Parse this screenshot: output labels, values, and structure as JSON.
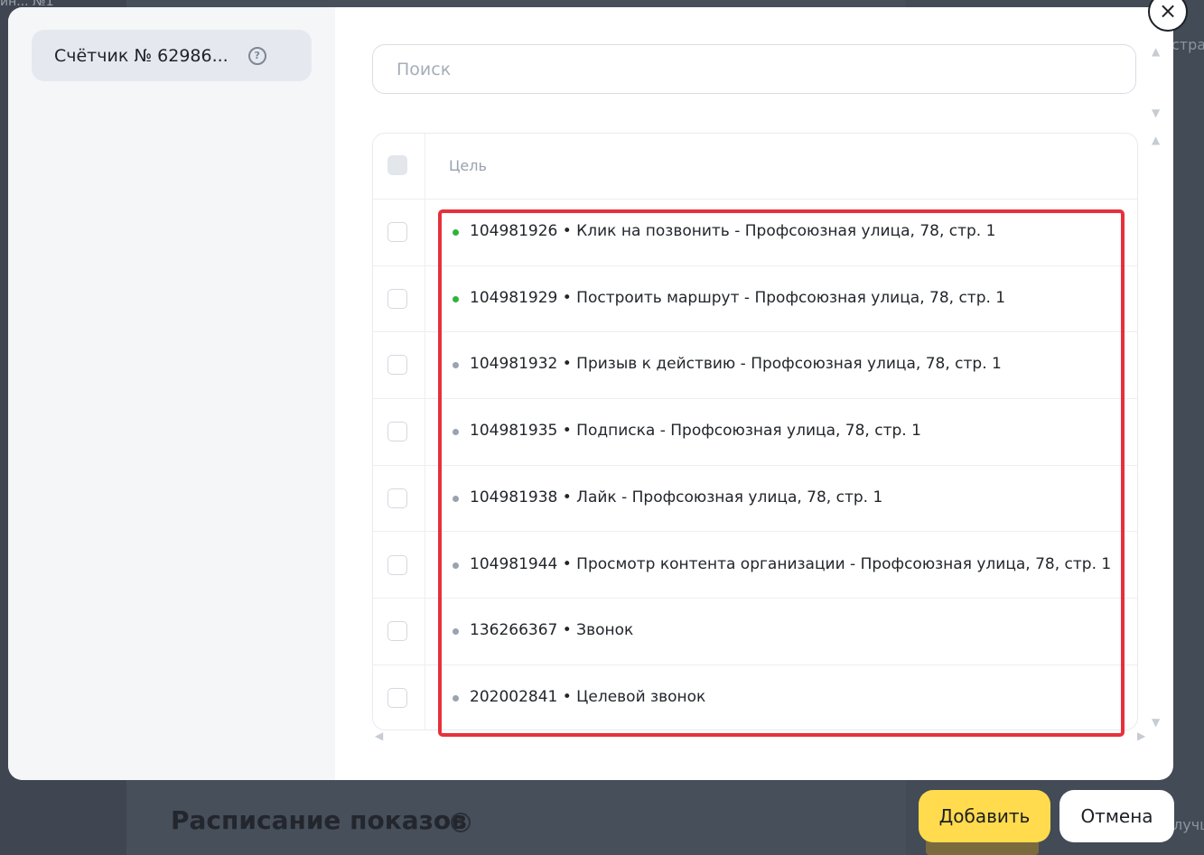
{
  "background": {
    "top_crumb": "ин... №1",
    "right_text_top": "стра",
    "right_text_bottom": "лучш",
    "heading": "Расписание показов",
    "heading_help": "?"
  },
  "sidebar": {
    "counter_label": "Счётчик № 62986...",
    "help": "?"
  },
  "search": {
    "placeholder": "Поиск",
    "value": ""
  },
  "table": {
    "column_title": "Цель",
    "rows": [
      {
        "text": "104981926 • Клик на позвонить - Профсоюзная улица, 78, стр. 1",
        "status_color": "#2db43d"
      },
      {
        "text": "104981929 • Построить маршрут - Профсоюзная улица, 78, стр. 1",
        "status_color": "#2db43d"
      },
      {
        "text": "104981932 • Призыв к действию - Профсоюзная улица, 78, стр. 1",
        "status_color": "#9aa3b0"
      },
      {
        "text": "104981935 • Подписка - Профсоюзная улица, 78, стр. 1",
        "status_color": "#9aa3b0"
      },
      {
        "text": "104981938 • Лайк - Профсоюзная улица, 78, стр. 1",
        "status_color": "#9aa3b0"
      },
      {
        "text": "104981944 • Просмотр контента организации - Профсоюзная улица, 78, стр. 1",
        "status_color": "#9aa3b0"
      },
      {
        "text": "136266367 • Звонок",
        "status_color": "#9aa3b0"
      },
      {
        "text": "202002841 • Целевой звонок",
        "status_color": "#9aa3b0"
      }
    ]
  },
  "close_icon": "×",
  "buttons": {
    "add": "Добавить",
    "cancel": "Отмена"
  },
  "colors": {
    "accent_yellow": "#ffdb4d",
    "highlight_red": "#e5313c",
    "active_green": "#2db43d",
    "inactive_gray": "#9aa3b0"
  }
}
